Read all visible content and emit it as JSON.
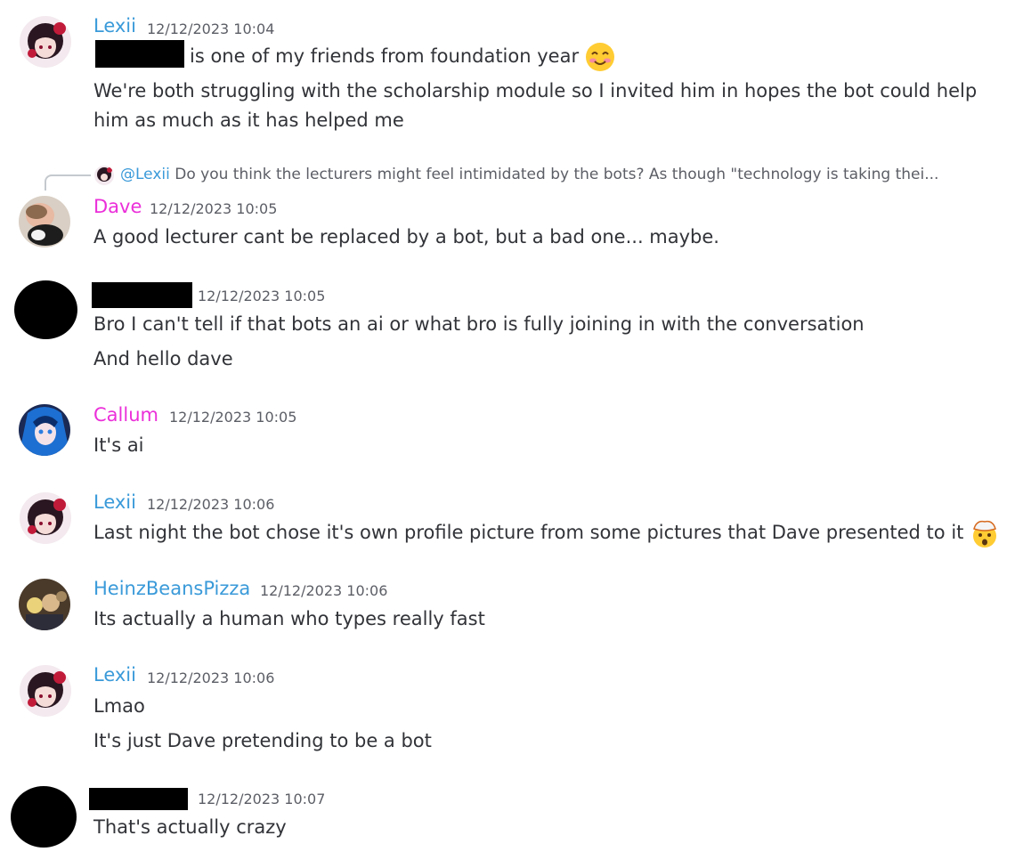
{
  "colors": {
    "lexii": "#3a9ad9",
    "dave": "#eb2fd9",
    "callum": "#eb2fd9",
    "heinz": "#3a9ad9",
    "timestamp": "#5c5e66",
    "text": "#313338"
  },
  "messages": [
    {
      "author": "Lexii",
      "timestamp": "12/12/2023 10:04",
      "lines": [
        "is one of my friends from foundation year",
        "We're both struggling with the scholarship module so I invited him in hopes the bot could help",
        "him as much as it has helped me"
      ],
      "emoji": "smiling-blush-emoji"
    },
    {
      "author": "Dave",
      "timestamp": "12/12/2023 10:05",
      "reply": {
        "mention": "@Lexii",
        "text": "Do you think the lecturers might feel intimidated by the bots? As though \"technology is taking thei..."
      },
      "lines": [
        "A good lecturer cant be replaced by a bot, but a bad one... maybe."
      ]
    },
    {
      "author": "",
      "timestamp": "12/12/2023 10:05",
      "lines": [
        "Bro I can't tell if that bots an ai or what bro is fully joining in with the conversation",
        "And hello dave"
      ]
    },
    {
      "author": "Callum",
      "timestamp": "12/12/2023 10:05",
      "lines": [
        "It's ai"
      ]
    },
    {
      "author": "Lexii",
      "timestamp": "12/12/2023 10:06",
      "lines": [
        "Last night the bot chose it's own profile picture from some pictures that Dave presented to it"
      ],
      "emoji": "exploding-head-emoji"
    },
    {
      "author": "HeinzBeansPizza",
      "timestamp": "12/12/2023 10:06",
      "lines": [
        "Its actually a human who types really fast"
      ]
    },
    {
      "author": "Lexii",
      "timestamp": "12/12/2023 10:06",
      "lines": [
        "Lmao",
        "It's just Dave pretending to be a bot"
      ]
    },
    {
      "author": "",
      "timestamp": "12/12/2023 10:07",
      "lines": [
        "That's actually crazy"
      ]
    }
  ]
}
